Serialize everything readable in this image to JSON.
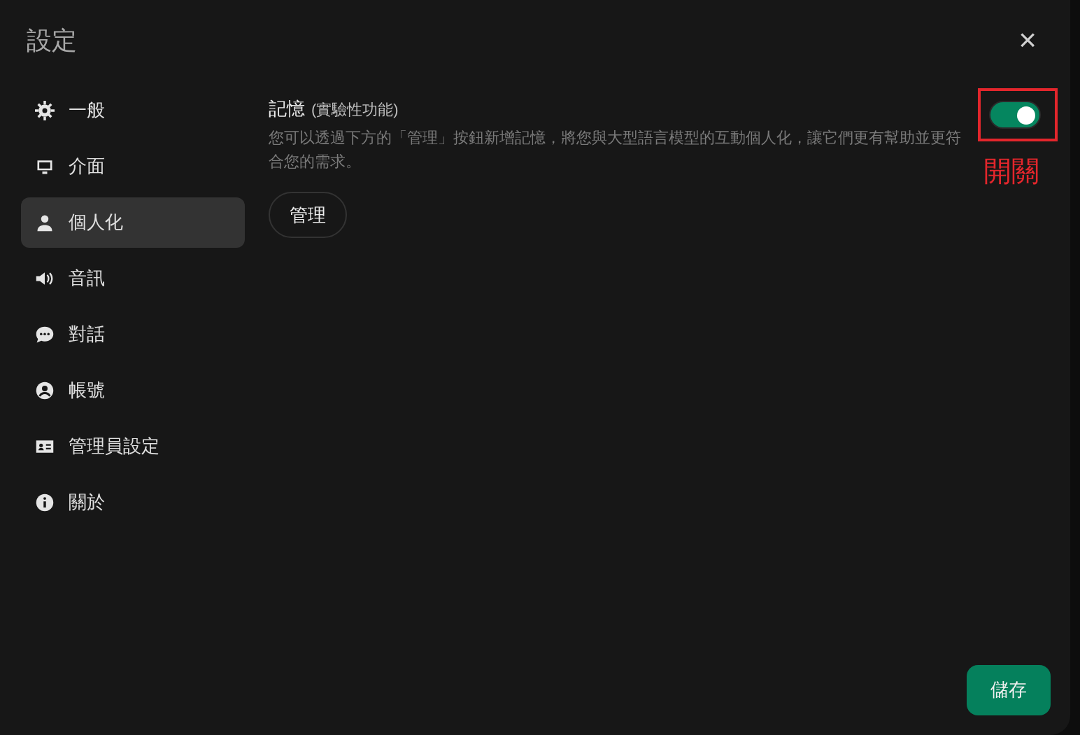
{
  "dialog": {
    "title": "設定",
    "close": "×"
  },
  "sidebar": {
    "items": [
      {
        "label": "一般",
        "selected": false
      },
      {
        "label": "介面",
        "selected": false
      },
      {
        "label": "個人化",
        "selected": true
      },
      {
        "label": "音訊",
        "selected": false
      },
      {
        "label": "對話",
        "selected": false
      },
      {
        "label": "帳號",
        "selected": false
      },
      {
        "label": "管理員設定",
        "selected": false
      },
      {
        "label": "關於",
        "selected": false
      }
    ]
  },
  "memory": {
    "title": "記憶",
    "note": "(實驗性功能)",
    "on": true,
    "description": "您可以透過下方的「管理」按鈕新增記憶，將您與大型語言模型的互動個人化，讓它們更有幫助並更符合您的需求。",
    "manage_button": "管理"
  },
  "annotation": {
    "label": "開關"
  },
  "save_button": "儲存"
}
